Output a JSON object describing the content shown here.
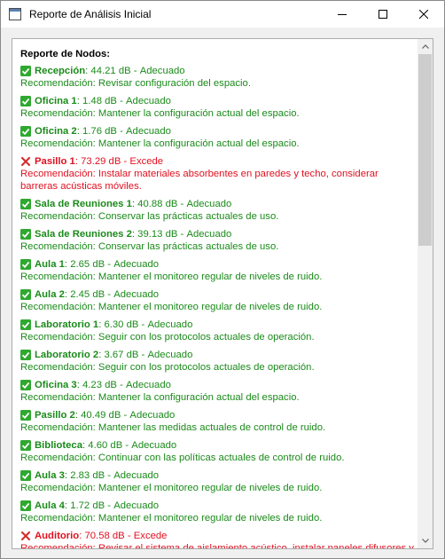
{
  "window": {
    "title": "Reporte de Análisis Inicial"
  },
  "report": {
    "heading": "Reporte de Nodos:",
    "rec_prefix": "Recomendación: ",
    "nodes": [
      {
        "name": "Recepción",
        "value": "44.21 dB",
        "status": "Adecuado",
        "ok": true,
        "recommendation": "Revisar configuración del espacio."
      },
      {
        "name": "Oficina 1",
        "value": "1.48 dB",
        "status": "Adecuado",
        "ok": true,
        "recommendation": "Mantener la configuración actual del espacio."
      },
      {
        "name": "Oficina 2",
        "value": "1.76 dB",
        "status": "Adecuado",
        "ok": true,
        "recommendation": "Mantener la configuración actual del espacio."
      },
      {
        "name": "Pasillo 1",
        "value": "73.29 dB",
        "status": "Excede",
        "ok": false,
        "recommendation": "Instalar materiales absorbentes en paredes y techo, considerar barreras acústicas móviles."
      },
      {
        "name": "Sala de Reuniones 1",
        "value": "40.88 dB",
        "status": "Adecuado",
        "ok": true,
        "recommendation": "Conservar las prácticas actuales de uso."
      },
      {
        "name": "Sala de Reuniones 2",
        "value": "39.13 dB",
        "status": "Adecuado",
        "ok": true,
        "recommendation": "Conservar las prácticas actuales de uso."
      },
      {
        "name": "Aula 1",
        "value": "2.65 dB",
        "status": "Adecuado",
        "ok": true,
        "recommendation": "Mantener el monitoreo regular de niveles de ruido."
      },
      {
        "name": "Aula 2",
        "value": "2.45 dB",
        "status": "Adecuado",
        "ok": true,
        "recommendation": "Mantener el monitoreo regular de niveles de ruido."
      },
      {
        "name": "Laboratorio 1",
        "value": "6.30 dB",
        "status": "Adecuado",
        "ok": true,
        "recommendation": "Seguir con los protocolos actuales de operación."
      },
      {
        "name": "Laboratorio 2",
        "value": "3.67 dB",
        "status": "Adecuado",
        "ok": true,
        "recommendation": "Seguir con los protocolos actuales de operación."
      },
      {
        "name": "Oficina 3",
        "value": "4.23 dB",
        "status": "Adecuado",
        "ok": true,
        "recommendation": "Mantener la configuración actual del espacio."
      },
      {
        "name": "Pasillo 2",
        "value": "40.49 dB",
        "status": "Adecuado",
        "ok": true,
        "recommendation": "Mantener las medidas actuales de control de ruido."
      },
      {
        "name": "Biblioteca",
        "value": "4.60 dB",
        "status": "Adecuado",
        "ok": true,
        "recommendation": "Continuar con las políticas actuales de control de ruido."
      },
      {
        "name": "Aula 3",
        "value": "2.83 dB",
        "status": "Adecuado",
        "ok": true,
        "recommendation": "Mantener el monitoreo regular de niveles de ruido."
      },
      {
        "name": "Aula 4",
        "value": "1.72 dB",
        "status": "Adecuado",
        "ok": true,
        "recommendation": "Mantener el monitoreo regular de niveles de ruido."
      },
      {
        "name": "Auditorio",
        "value": "70.58 dB",
        "status": "Excede",
        "ok": false,
        "recommendation": "Revisar el sistema de aislamiento acústico, instalar paneles difusores y"
      }
    ]
  },
  "colors": {
    "ok": "#1a8a1a",
    "bad": "#e01020",
    "check_bg": "#2fa82f"
  },
  "icons": {
    "ok": "check-mark-icon",
    "bad": "cross-mark-icon"
  },
  "scroll": {
    "visible_fraction": 0.4
  }
}
